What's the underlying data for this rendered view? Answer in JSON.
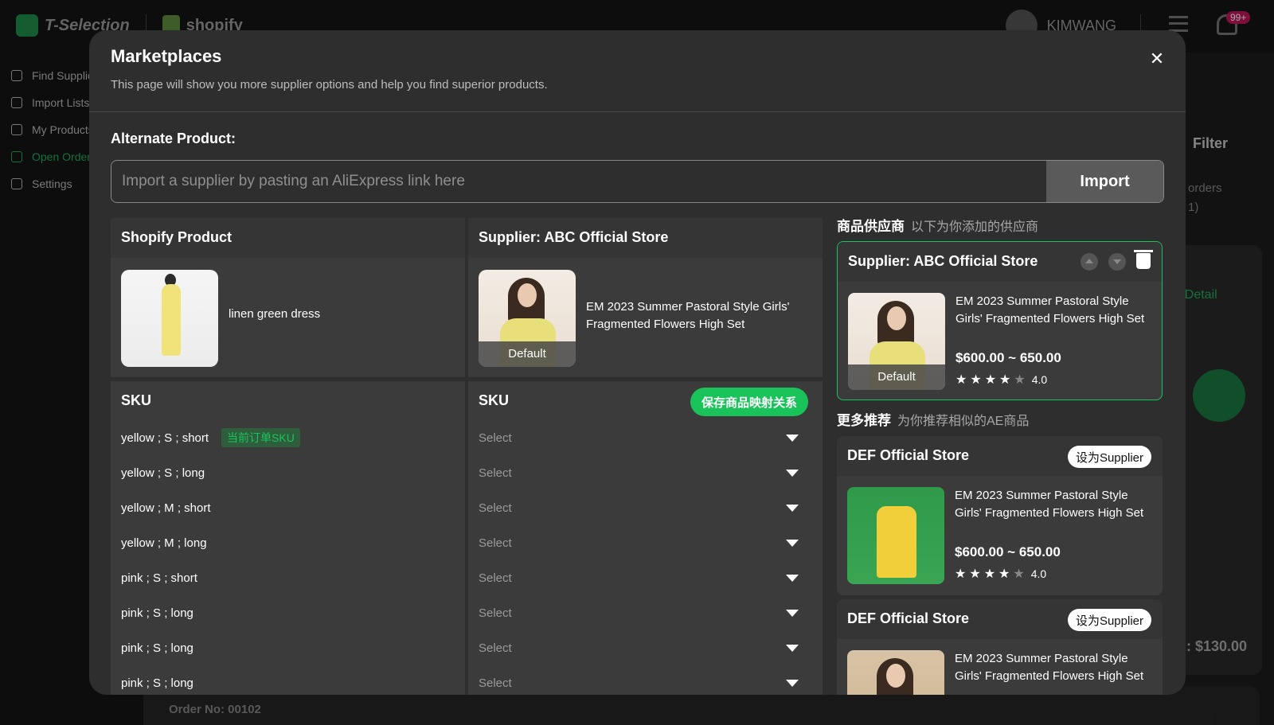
{
  "app": {
    "brand": "T-Selection",
    "shopify": "shopify",
    "user_name": "KIMWANG",
    "notif_badge": "99+",
    "sidebar": [
      {
        "label": "Find Suppliers",
        "active": false
      },
      {
        "label": "Import Lists",
        "active": false
      },
      {
        "label": "My Products",
        "active": false
      },
      {
        "label": "Open Orders",
        "active": true
      },
      {
        "label": "Settings",
        "active": false
      }
    ],
    "filter": "Filter",
    "orders_line1": "orders",
    "orders_line2": "1)",
    "detail_link": "r Detail",
    "total": ": $130.00",
    "order_no": "Order No: 00102"
  },
  "modal": {
    "title": "Marketplaces",
    "subtitle": "This page will show you more supplier options and help you find superior products.",
    "alt_label": "Alternate Product:",
    "import_placeholder": "Import a supplier by pasting an AliExpress link here",
    "import_button": "Import",
    "shopify_col_title": "Shopify Product",
    "shopify_product_name": "linen green dress",
    "supplier_col_title": "Supplier: ABC Official Store",
    "supplier_product_name": "EM 2023 Summer Pastoral Style Girls' Fragmented Flowers High Set",
    "default_tag": "Default",
    "sku_title": "SKU",
    "save_mapping_button": "保存商品映射关系",
    "current_sku_badge": "当前订单SKU",
    "select_placeholder": "Select",
    "skus": [
      "yellow ; S ; short",
      "yellow ; S ; long",
      "yellow ; M ; short",
      "yellow ; M ; long",
      "pink ; S ; short",
      "pink ; S ; long",
      "pink ; S ; long",
      "pink ; S ; long"
    ]
  },
  "right_panel": {
    "suppliers_label": "商品供应商",
    "suppliers_hint": "以下为你添加的供应商",
    "supplier_card": {
      "title": "Supplier: ABC Official Store",
      "product": "EM 2023 Summer Pastoral Style Girls' Fragmented Flowers High Set",
      "price": "$600.00 ~ 650.00",
      "rating": "4.0",
      "stars_filled": 4,
      "tag": "Default"
    },
    "more_label": "更多推荐",
    "more_hint": "为你推荐相似的AE商品",
    "recommendations": [
      {
        "store": "DEF Official Store",
        "button": "设为Supplier",
        "product": "EM 2023 Summer Pastoral Style Girls' Fragmented Flowers High Set",
        "price": "$600.00 ~ 650.00",
        "rating": "4.0"
      },
      {
        "store": "DEF Official Store",
        "button": "设为Supplier",
        "product": "EM 2023 Summer Pastoral Style Girls' Fragmented Flowers High Set"
      }
    ]
  },
  "colors": {
    "accent_green": "#19c35a",
    "modal_bg": "#2e2e2e",
    "panel_bg": "#3b3b3b"
  }
}
